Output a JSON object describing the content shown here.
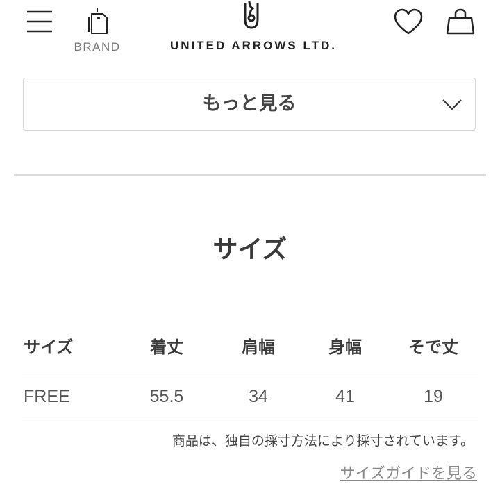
{
  "header": {
    "brand_label": "BRAND",
    "logo_text": "UNITED ARROWS LTD.",
    "icons": [
      "menu-icon",
      "tag-icon",
      "logo-mark-icon",
      "heart-icon",
      "bag-icon"
    ]
  },
  "more_button": {
    "label": "もっと見る",
    "icon": "chevron-down-icon"
  },
  "size_section": {
    "title": "サイズ",
    "columns": [
      "サイズ",
      "着丈",
      "肩幅",
      "身幅",
      "そで丈"
    ],
    "rows": [
      [
        "FREE",
        "55.5",
        "34",
        "41",
        "19"
      ]
    ],
    "note": "商品は、独自の採寸方法により採寸されています。",
    "guide_link": "サイズガイドを見る"
  },
  "colors": {
    "text": "#333333",
    "muted": "#888888",
    "border": "#d6d6d6"
  }
}
